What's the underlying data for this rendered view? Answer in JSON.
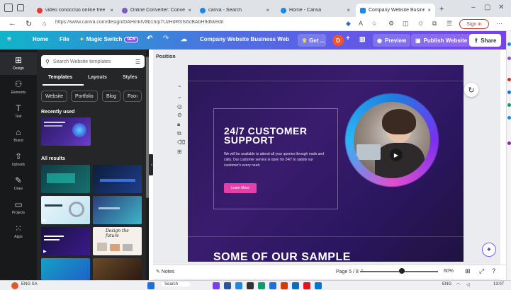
{
  "browser": {
    "tabs": [
      {
        "title": "video conoccsio online free",
        "active": false,
        "color": "#e53935"
      },
      {
        "title": "Online Converter: Convert imag",
        "active": false,
        "color": "#7e57c2"
      },
      {
        "title": "canva - Search",
        "active": false,
        "color": "#1e88e5"
      },
      {
        "title": "Home - Canva",
        "active": false,
        "color": "#1e88e5"
      },
      {
        "title": "Company Website Business Web",
        "active": true,
        "color": "#1e88e5"
      }
    ],
    "url": "https://www.canva.com/design/DAHmkIV8b1h/p7UzHdRSfs6cBAbH9dM/edit",
    "sign_in_label": "Sign in"
  },
  "canva_header": {
    "home": "Home",
    "file": "File",
    "magic_switch": "Magic Switch",
    "new_badge": "NEW",
    "doc_title": "Company Website Business Website l...",
    "get_pro": "Get ...",
    "avatar_initial": "D",
    "preview": "Preview",
    "publish": "Publish Website",
    "share": "Share"
  },
  "rail": [
    {
      "label": "Design",
      "icon": "layout-icon",
      "glyph": "⊞"
    },
    {
      "label": "Elements",
      "icon": "shapes-icon",
      "glyph": "⚇"
    },
    {
      "label": "Text",
      "icon": "text-icon",
      "glyph": "T"
    },
    {
      "label": "Brand",
      "icon": "brand-icon",
      "glyph": "⌂"
    },
    {
      "label": "Uploads",
      "icon": "upload-icon",
      "glyph": "⇧"
    },
    {
      "label": "Draw",
      "icon": "pen-icon",
      "glyph": "✎"
    },
    {
      "label": "Projects",
      "icon": "folder-icon",
      "glyph": "▭"
    },
    {
      "label": "Apps",
      "icon": "apps-icon",
      "glyph": "⁙"
    }
  ],
  "panel": {
    "search_placeholder": "Search Website templates",
    "tabs": [
      "Templates",
      "Layouts",
      "Styles"
    ],
    "chips": [
      "Website",
      "Portfolio",
      "Blog",
      "Foo"
    ],
    "recently_used": "Recently used",
    "all_results": "All results",
    "thumb_design_text": "Design the future"
  },
  "editor": {
    "position_label": "Position",
    "notes_label": "Notes",
    "page_indicator": "Page 5 / 8",
    "zoom": "60%"
  },
  "slide": {
    "title_line1": "24/7 CUSTOMER",
    "title_line2": "SUPPORT",
    "body": "We will be available to attend all your queries through mails and calls. Our customer service is open for 24/7 to satisfy our customer's every need.",
    "button": "Learn More",
    "bottom_heading": "SOME OF OUR SAMPLE"
  },
  "taskbar": {
    "weather": "ENG SA",
    "search": "Search",
    "lang": "ENG",
    "time": "13:07"
  }
}
